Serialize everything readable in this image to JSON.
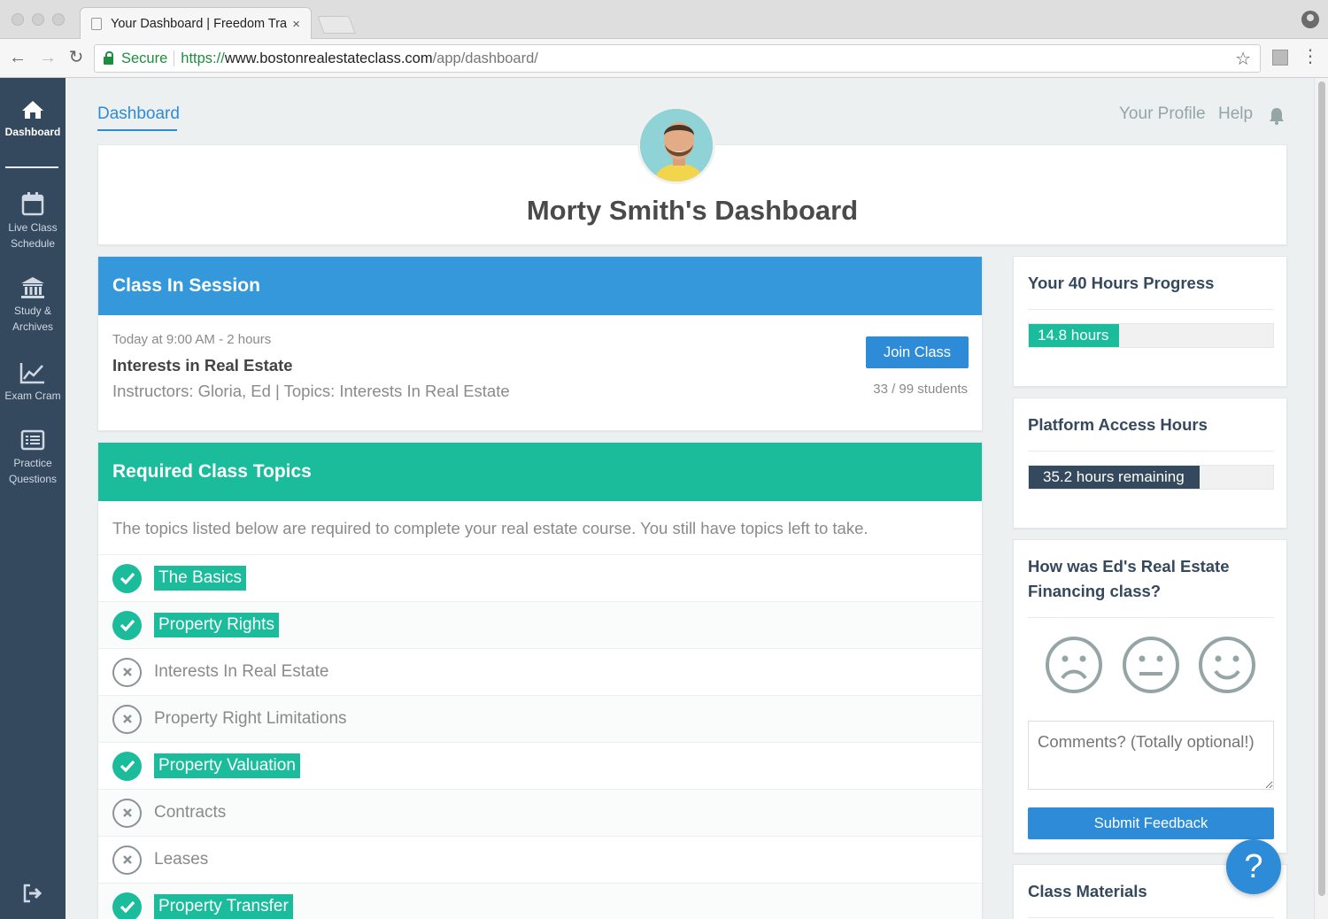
{
  "browser": {
    "tab_title": "Your Dashboard | Freedom Tra",
    "tab_close": "×",
    "secure_label": "Secure",
    "url_scheme": "https://",
    "url_host": "www.bostonrealestateclass.com",
    "url_path": "/app/dashboard/"
  },
  "sidebar": {
    "items": [
      {
        "label": "Dashboard",
        "icon": "home-icon"
      },
      {
        "label": "Live Class Schedule",
        "icon": "calendar-icon"
      },
      {
        "label": "Study & Archives",
        "icon": "bank-icon"
      },
      {
        "label": "Exam Cram",
        "icon": "chart-line-icon"
      },
      {
        "label": "Practice Questions",
        "icon": "list-icon"
      }
    ],
    "logout_icon": "logout-icon"
  },
  "topnav": {
    "active": "Dashboard",
    "profile": "Your Profile",
    "help": "Help",
    "bell_icon": "bell-icon"
  },
  "header": {
    "title": "Morty Smith's Dashboard"
  },
  "class_in_session": {
    "heading": "Class In Session",
    "time": "Today at 9:00 AM - 2 hours",
    "class_name": "Interests in Real Estate",
    "details": "Instructors: Gloria, Ed | Topics: Interests In Real Estate",
    "join_label": "Join Class",
    "students": "33 / 99 students",
    "header_color": "#3498db"
  },
  "required_topics": {
    "heading": "Required Class Topics",
    "intro": "The topics listed below are required to complete your real estate course. You still have topics left to take.",
    "header_color": "#1abc9c",
    "topics": [
      {
        "name": "The Basics",
        "done": true
      },
      {
        "name": "Property Rights",
        "done": true
      },
      {
        "name": "Interests In Real Estate",
        "done": false
      },
      {
        "name": "Property Right Limitations",
        "done": false
      },
      {
        "name": "Property Valuation",
        "done": true
      },
      {
        "name": "Contracts",
        "done": false
      },
      {
        "name": "Leases",
        "done": false
      },
      {
        "name": "Property Transfer",
        "done": true
      }
    ]
  },
  "progress": {
    "title": "Your 40 Hours Progress",
    "label": "14.8 hours",
    "fraction": 0.37
  },
  "access": {
    "title": "Platform Access Hours",
    "label": "35.2 hours remaining",
    "fraction": 0.7
  },
  "feedback": {
    "title": "How was Ed's Real Estate Financing class?",
    "faces": [
      "sad-face-icon",
      "neutral-face-icon",
      "happy-face-icon"
    ],
    "comments_placeholder": "Comments? (Totally optional!)",
    "submit_label": "Submit Feedback"
  },
  "materials": {
    "title": "Class Materials"
  },
  "help_fab": "?"
}
